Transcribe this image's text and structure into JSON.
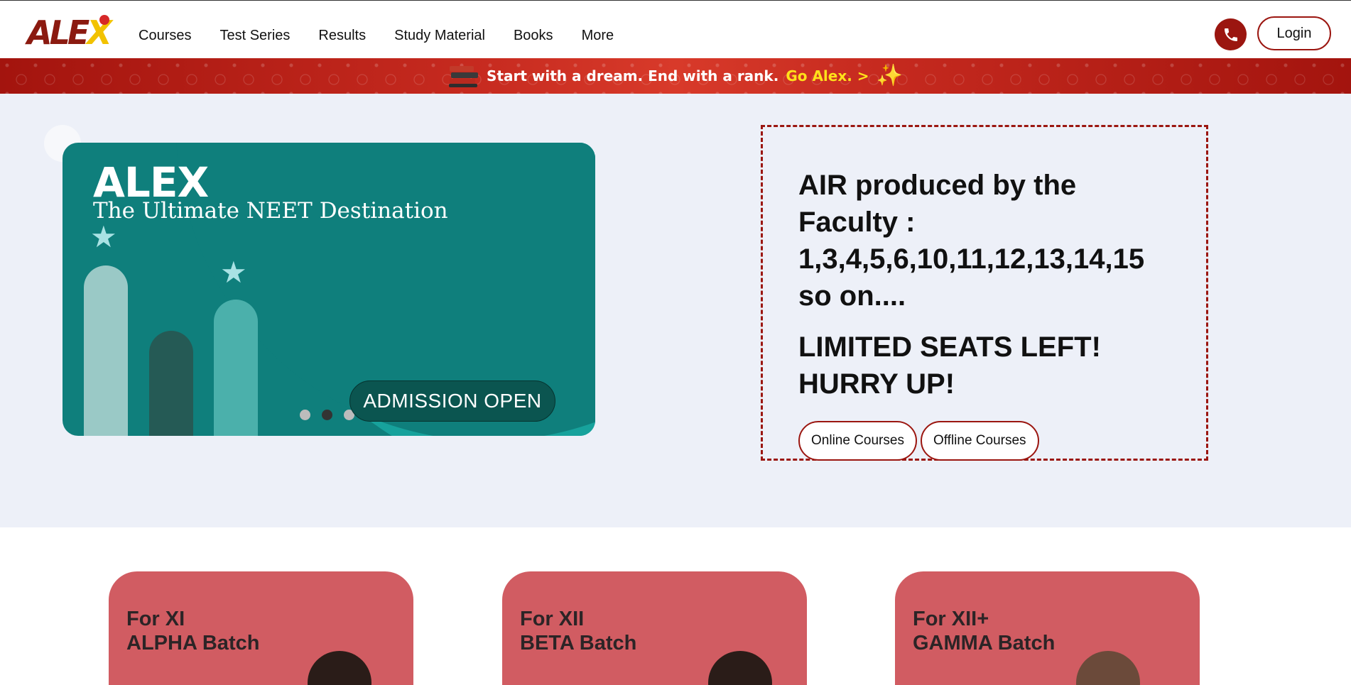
{
  "header": {
    "logo_text_main": "ALE",
    "logo_text_x": "X",
    "nav": [
      "Courses",
      "Test Series",
      "Results",
      "Study Material",
      "Books",
      "More"
    ],
    "login_label": "Login"
  },
  "banner": {
    "text": "Start with a dream. End with a rank.",
    "link": "Go Alex. >"
  },
  "hero": {
    "slide": {
      "brand": "ALEX",
      "tagline": "The Ultimate NEET Destination",
      "cta": "ADMISSION OPEN",
      "slide_count": 3,
      "active_slide": 2
    },
    "info": {
      "air_line1": "AIR produced by the Faculty :",
      "air_line2": "1,3,4,5,6,10,11,12,13,14,15",
      "air_line3": "so on....",
      "seats_line1": "LIMITED SEATS LEFT!",
      "seats_line2": "HURRY UP!",
      "buttons": [
        "Online Courses",
        "Offline Courses"
      ]
    }
  },
  "batches": [
    {
      "line1": "For XI",
      "line2": "ALPHA Batch"
    },
    {
      "line1": "For XII",
      "line2": "BETA Batch"
    },
    {
      "line1": "For XII+",
      "line2": "GAMMA Batch"
    }
  ],
  "colors": {
    "brand_red": "#9b1610",
    "teal": "#0f7f7c",
    "card_red": "#d15c62",
    "hero_bg": "#edf0f8",
    "banner_highlight": "#ffe11a"
  }
}
